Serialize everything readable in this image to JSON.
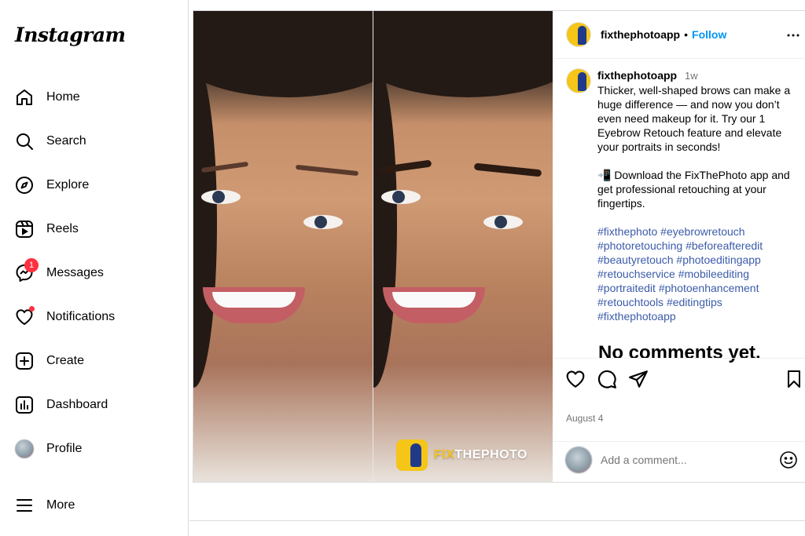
{
  "sidebar": {
    "logo": "Instagram",
    "items": [
      {
        "label": "Home",
        "icon": "home-icon"
      },
      {
        "label": "Search",
        "icon": "search-icon"
      },
      {
        "label": "Explore",
        "icon": "compass-icon"
      },
      {
        "label": "Reels",
        "icon": "reels-icon"
      },
      {
        "label": "Messages",
        "icon": "messenger-icon",
        "badge": "1"
      },
      {
        "label": "Notifications",
        "icon": "heart-icon"
      },
      {
        "label": "Create",
        "icon": "plus-square-icon"
      },
      {
        "label": "Dashboard",
        "icon": "dashboard-icon"
      },
      {
        "label": "Profile",
        "icon": "avatar"
      },
      {
        "label": "More",
        "icon": "menu-icon"
      }
    ]
  },
  "post": {
    "username": "fixthephotoapp",
    "separator": "•",
    "follow_label": "Follow",
    "caption_user": "fixthephotoapp",
    "caption_age": "1w",
    "caption_p1": "Thicker, well-shaped brows can make a huge difference — and now you don’t even need makeup for it. Try our 1 Eyebrow Retouch feature and elevate your portraits in seconds!",
    "caption_p2": "📲 Download the FixThePhoto app and get professional retouching at your fingertips.",
    "hashtags": "#fixthephoto #eyebrowretouch #photoretouching #beforeafteredit #beautyretouch #photoeditingapp #retouchservice #mobileediting #portraitedit #photoenhancement #retouchtools #editingtips #fixthephotoapp",
    "no_comments": "No comments yet.",
    "date": "August 4",
    "comment_placeholder": "Add a comment...",
    "watermark_a": "FIX",
    "watermark_b": "THEPHOTO"
  },
  "colors": {
    "accent": "#0095f6",
    "hashtag": "#3b5ba9",
    "badge": "#ff3040",
    "brand_yellow": "#f5c518"
  }
}
